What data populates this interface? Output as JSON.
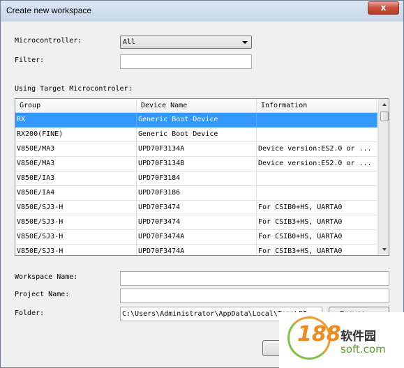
{
  "window": {
    "title": "Create new workspace",
    "close_glyph": "x"
  },
  "form": {
    "microcontroller_label": "Microcontroller:",
    "microcontroller_value": "All",
    "filter_label": "Filter:",
    "filter_value": "",
    "list_label": "Using Target Microcontroler:"
  },
  "table": {
    "columns": [
      "Group",
      "Device Name",
      "Information"
    ],
    "rows": [
      {
        "group": "RX",
        "device": "Generic Boot Device",
        "info": "",
        "selected": true
      },
      {
        "group": "RX200(FINE)",
        "device": "Generic Boot Device",
        "info": "",
        "selected": false
      },
      {
        "group": "V850E/MA3",
        "device": "UPD70F3134A",
        "info": "Device version:ES2.0 or ...",
        "selected": false
      },
      {
        "group": "V850E/MA3",
        "device": "UPD70F3134B",
        "info": "Device version:ES2.0 or ...",
        "selected": false
      },
      {
        "group": "V850E/IA3",
        "device": "UPD70F3184",
        "info": "",
        "selected": false
      },
      {
        "group": "V850E/IA4",
        "device": "UPD70F3186",
        "info": "",
        "selected": false
      },
      {
        "group": "V850E/SJ3-H",
        "device": "UPD70F3474",
        "info": "For CSIB0+HS, UARTA0",
        "selected": false
      },
      {
        "group": "V850E/SJ3-H",
        "device": "UPD70F3474",
        "info": "For CSIB3+HS, UARTA0",
        "selected": false
      },
      {
        "group": "V850E/SJ3-H",
        "device": "UPD70F3474A",
        "info": "For CSIB0+HS, UARTA0",
        "selected": false
      },
      {
        "group": "V850E/SJ3-H",
        "device": "UPD70F3474A",
        "info": "For CSIB3+HS, UARTA0",
        "selected": false
      }
    ]
  },
  "workspace": {
    "workspace_name_label": "Workspace Name:",
    "workspace_name_value": "",
    "project_name_label": "Project Name:",
    "project_name_value": "",
    "folder_label": "Folder:",
    "folder_value": "C:\\Users\\Administrator\\AppData\\Local\\Temp\\FI",
    "browse_label": "Browse..."
  },
  "watermark": {
    "number": "188",
    "brand": "软件园",
    "url": "soft.com"
  },
  "colors": {
    "selection": "#3399ff",
    "close_button": "#c9543e"
  }
}
